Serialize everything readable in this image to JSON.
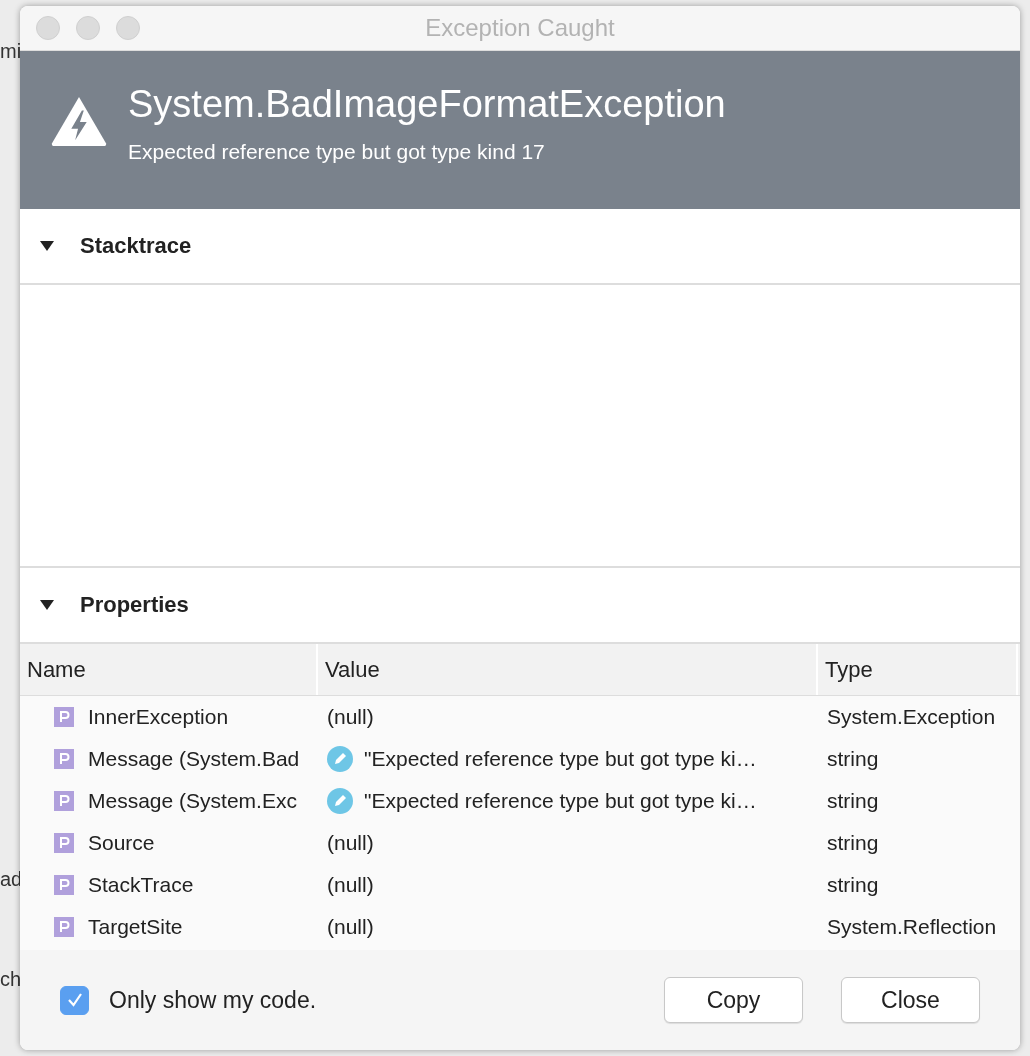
{
  "background": {
    "fragments": [
      "mi",
      "ad",
      "ch"
    ]
  },
  "window": {
    "title": "Exception Caught"
  },
  "exception": {
    "type": "System.BadImageFormatException",
    "message": "Expected reference type but got type kind 17"
  },
  "sections": [
    {
      "title": "Stacktrace",
      "expanded": true
    },
    {
      "title": "Properties",
      "expanded": true
    }
  ],
  "table": {
    "columns": [
      "Name",
      "Value",
      "Type"
    ],
    "rows": [
      {
        "name": "InnerException",
        "value": "(null)",
        "editable": false,
        "type": "System.Exception"
      },
      {
        "name": "Message (System.Bad",
        "value": "\"Expected reference type but got type ki…",
        "editable": true,
        "type": "string"
      },
      {
        "name": "Message (System.Exc",
        "value": "\"Expected reference type but got type ki…",
        "editable": true,
        "type": "string"
      },
      {
        "name": "Source",
        "value": "(null)",
        "editable": false,
        "type": "string"
      },
      {
        "name": "StackTrace",
        "value": "(null)",
        "editable": false,
        "type": "string"
      },
      {
        "name": "TargetSite",
        "value": "(null)",
        "editable": false,
        "type": "System.Reflection"
      }
    ]
  },
  "footer": {
    "checkbox": {
      "label": "Only show my code.",
      "checked": true
    },
    "buttons": [
      "Copy",
      "Close"
    ]
  }
}
